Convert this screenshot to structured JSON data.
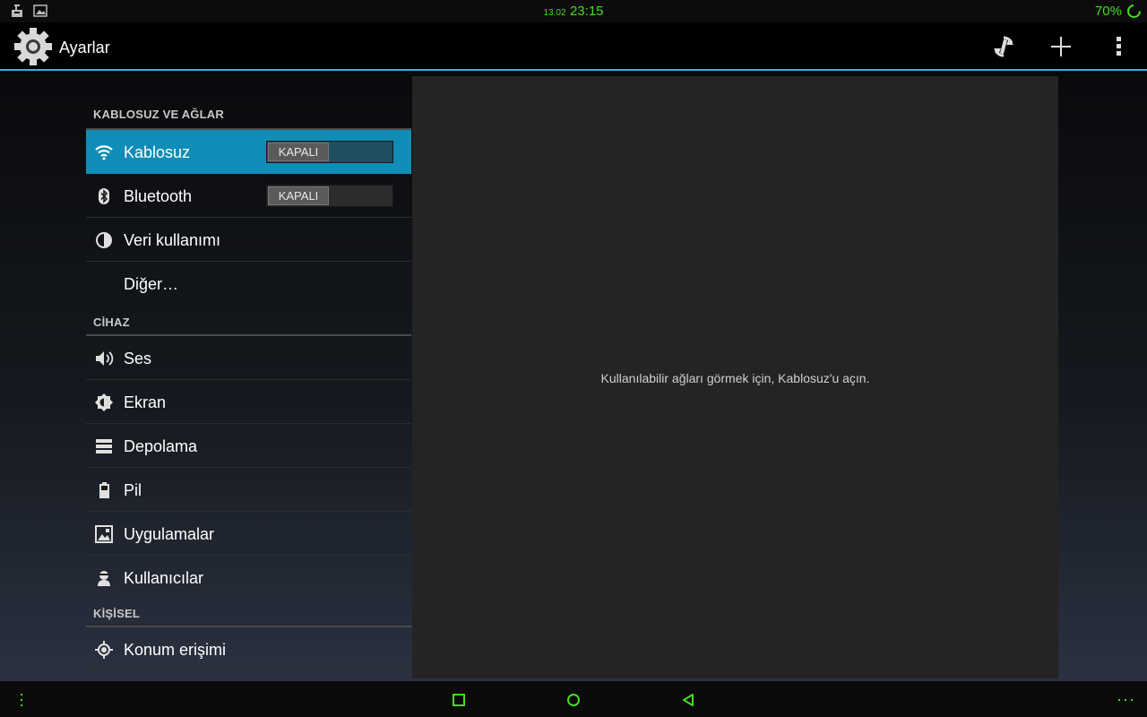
{
  "status_bar": {
    "date": "13.02",
    "time": "23:15",
    "battery": "70%",
    "left_icons": [
      "android-debug-icon",
      "image-icon"
    ],
    "accent": "#44dd22"
  },
  "action_bar": {
    "title": "Ayarlar",
    "icon": "settings-gear-icon",
    "actions": [
      "sync-icon",
      "add-icon",
      "overflow-menu-icon"
    ],
    "accent_line": "#33b5e5"
  },
  "nav": {
    "sections": [
      {
        "header": "KABLOSUZ VE AĞLAR",
        "items": [
          {
            "label": "Kablosuz",
            "icon": "wifi-icon",
            "toggle": "KAPALI",
            "selected": true
          },
          {
            "label": "Bluetooth",
            "icon": "bluetooth-icon",
            "toggle": "KAPALI"
          },
          {
            "label": "Veri kullanımı",
            "icon": "data-usage-icon"
          },
          {
            "label": "Diğer…",
            "icon": ""
          }
        ]
      },
      {
        "header": "CİHAZ",
        "items": [
          {
            "label": "Ses",
            "icon": "volume-icon"
          },
          {
            "label": "Ekran",
            "icon": "brightness-icon"
          },
          {
            "label": "Depolama",
            "icon": "storage-icon"
          },
          {
            "label": "Pil",
            "icon": "battery-icon"
          },
          {
            "label": "Uygulamalar",
            "icon": "apps-icon"
          },
          {
            "label": "Kullanıcılar",
            "icon": "user-icon"
          }
        ]
      },
      {
        "header": "KİŞİSEL",
        "items": [
          {
            "label": "Konum erişimi",
            "icon": "location-icon"
          }
        ]
      }
    ],
    "selected_color": "#0f8db7"
  },
  "detail": {
    "message": "Kullanılabilir ağları görmek için, Kablosuz'u açın."
  },
  "nav_bar": {
    "buttons": [
      "menu-dots-icon",
      "recent-apps-icon",
      "home-icon",
      "back-icon",
      "more-dots-icon"
    ],
    "color": "#44dd22"
  }
}
